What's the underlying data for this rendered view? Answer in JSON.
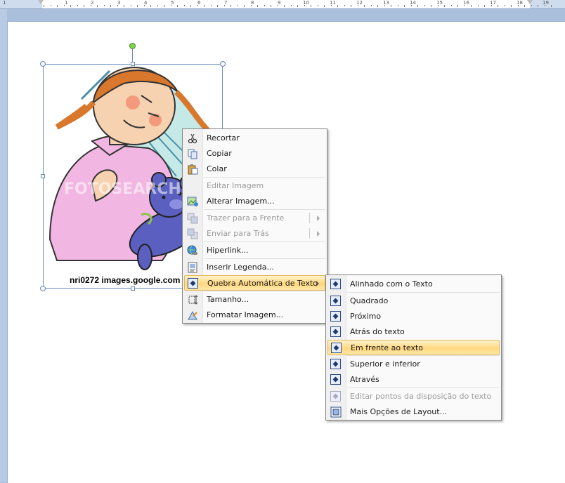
{
  "ruler": {
    "numbers": [
      "1",
      "1",
      "2",
      "3",
      "4",
      "5",
      "6",
      "7",
      "8",
      "9",
      "10",
      "11",
      "12",
      "13",
      "14",
      "15",
      "16",
      "17",
      "18",
      "19"
    ]
  },
  "image": {
    "caption": "nri0272  images.google.com",
    "watermark": "FOTOSEARCH"
  },
  "context_menu": {
    "items": [
      {
        "label": "Recortar",
        "icon": "scissors-icon",
        "enabled": true
      },
      {
        "label": "Copiar",
        "icon": "copy-icon",
        "enabled": true
      },
      {
        "label": "Colar",
        "icon": "paste-icon",
        "enabled": true
      },
      {
        "label": "Editar Imagem",
        "icon": "",
        "enabled": false
      },
      {
        "label": "Alterar Imagem...",
        "icon": "change-picture-icon",
        "enabled": true
      },
      {
        "label": "Trazer para a Frente",
        "icon": "bring-to-front-icon",
        "enabled": false
      },
      {
        "label": "Enviar para Trás",
        "icon": "send-to-back-icon",
        "enabled": false
      },
      {
        "label": "Hiperlink...",
        "icon": "hyperlink-icon",
        "enabled": true
      },
      {
        "label": "Inserir Legenda...",
        "icon": "caption-icon",
        "enabled": true
      },
      {
        "label": "Quebra Automática de Texto",
        "icon": "text-wrap-icon",
        "enabled": true
      },
      {
        "label": "Tamanho...",
        "icon": "size-icon",
        "enabled": true
      },
      {
        "label": "Formatar Imagem...",
        "icon": "format-picture-icon",
        "enabled": true
      }
    ]
  },
  "wrap_submenu": {
    "items": [
      {
        "label": "Alinhado com o Texto",
        "enabled": true
      },
      {
        "label": "Quadrado",
        "enabled": true
      },
      {
        "label": "Próximo",
        "enabled": true
      },
      {
        "label": "Atrás do texto",
        "enabled": true
      },
      {
        "label": "Em frente ao texto",
        "enabled": true,
        "selected": true
      },
      {
        "label": "Superior e inferior",
        "enabled": true
      },
      {
        "label": "Através",
        "enabled": true
      },
      {
        "label": "Editar pontos da disposição do texto",
        "enabled": false
      },
      {
        "label": "Mais Opções de Layout...",
        "enabled": true
      }
    ]
  },
  "colors": {
    "highlight": "#ffd780",
    "menu_border": "#868686",
    "accent": "#2c4a80"
  }
}
